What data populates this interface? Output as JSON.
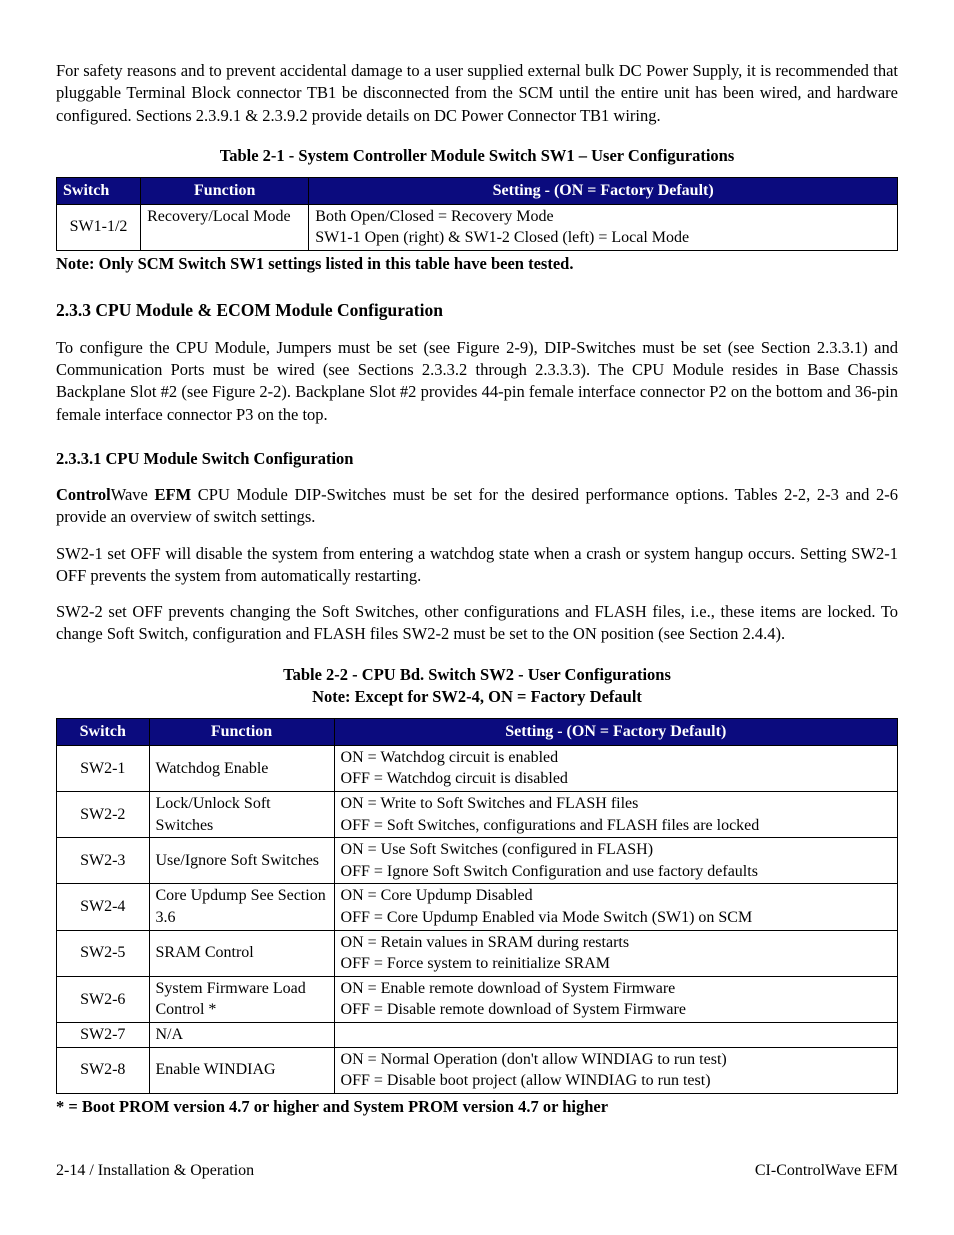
{
  "intro_para": "For safety reasons and to prevent accidental damage to a user supplied external bulk DC Power Supply, it is recommended that pluggable Terminal Block connector TB1 be disconnected from the SCM until the entire unit has been wired, and hardware configured. Sections 2.3.9.1 & 2.3.9.2 provide details on DC Power Connector TB1 wiring.",
  "table1": {
    "caption": "Table 2-1 - System Controller Module Switch SW1 – User Configurations",
    "headers": {
      "switch": "Switch",
      "function": "Function",
      "setting": "Setting - (ON = Factory Default)"
    },
    "row": {
      "switch": "SW1-1/2",
      "function": "Recovery/Local Mode",
      "setting_line1": "Both Open/Closed = Recovery Mode",
      "setting_line2": "SW1-1 Open (right) & SW1-2 Closed (left) = Local Mode"
    },
    "note": "Note: Only SCM Switch SW1 settings listed in this table have been tested."
  },
  "sec233": {
    "heading": "2.3.3  CPU Module & ECOM Module Configuration",
    "para": "To configure the CPU Module, Jumpers must be set (see Figure 2-9), DIP-Switches must be set (see Section 2.3.3.1) and Communication Ports must be wired (see Sections 2.3.3.2 through 2.3.3.3). The CPU Module resides in Base Chassis Backplane Slot #2 (see Figure 2-2). Backplane Slot #2 provides 44-pin female interface connector P2 on the bottom and 36-pin female interface connector P3 on the top."
  },
  "sec2331": {
    "heading": "2.3.3.1  CPU Module Switch Configuration",
    "para1_pre": "Control",
    "para1_mid": "Wave",
    "para1_post": " EFM",
    "para1_rest": " CPU Module DIP-Switches must be set for the desired performance options. Tables 2-2, 2-3 and 2-6 provide an overview of switch settings.",
    "para2": "SW2-1 set OFF will disable the system from entering a watchdog state when a crash or system hangup occurs. Setting SW2-1 OFF prevents the system from automatically restarting.",
    "para3": "SW2-2 set OFF prevents changing the Soft Switches, other configurations and FLASH files, i.e., these items are locked. To change Soft Switch, configuration and FLASH files SW2-2 must be set to the ON position (see Section 2.4.4)."
  },
  "table2": {
    "caption_line1": "Table 2-2 - CPU Bd. Switch SW2 - User Configurations",
    "caption_line2": "Note: Except for SW2-4, ON = Factory Default",
    "headers": {
      "switch": "Switch",
      "function": "Function",
      "setting": "Setting - (ON = Factory Default)"
    },
    "rows": [
      {
        "switch": "SW2-1",
        "function": "Watchdog Enable",
        "on": "ON   = Watchdog circuit is enabled",
        "off": "OFF = Watchdog circuit is disabled"
      },
      {
        "switch": "SW2-2",
        "function": "Lock/Unlock Soft Switches",
        "on": "ON   = Write to Soft Switches and FLASH files",
        "off": "OFF = Soft Switches, configurations and FLASH files are locked"
      },
      {
        "switch": "SW2-3",
        "function": "Use/Ignore Soft Switches",
        "on": "ON   = Use Soft Switches (configured in FLASH)",
        "off": "OFF = Ignore Soft Switch Configuration and use factory defaults"
      },
      {
        "switch": "SW2-4",
        "function": "Core Updump See Section 3.6",
        "on": "ON   = Core Updump Disabled",
        "off": "OFF = Core Updump Enabled via Mode Switch (SW1) on SCM"
      },
      {
        "switch": "SW2-5",
        "function": "SRAM Control",
        "on": "ON   = Retain values in SRAM during restarts",
        "off": "OFF = Force system to reinitialize SRAM"
      },
      {
        "switch": "SW2-6",
        "function": "System Firmware Load Control *",
        "on": "ON   = Enable remote download of System Firmware",
        "off": "OFF = Disable remote download of System Firmware"
      },
      {
        "switch": "SW2-7",
        "function": "N/A",
        "on": "",
        "off": ""
      },
      {
        "switch": "SW2-8",
        "function": "Enable WINDIAG",
        "on": "ON   = Normal Operation (don't allow WINDIAG to run test)",
        "off": "OFF = Disable boot project (allow WINDIAG to run test)"
      }
    ],
    "footnote": "* = Boot PROM version 4.7 or higher and System PROM version 4.7 or higher"
  },
  "footer": {
    "left": "2-14 / Installation & Operation",
    "right": "CI-ControlWave EFM"
  }
}
